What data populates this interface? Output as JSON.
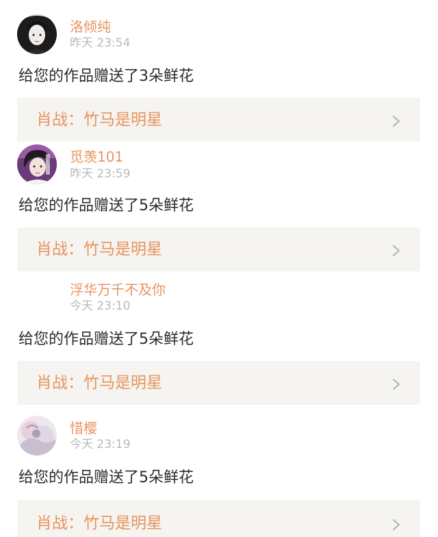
{
  "gifts": [
    {
      "username": "洛倾纯",
      "time": "昨天 23:54",
      "message": "给您的作品赠送了3朵鲜花",
      "work_title": "肖战：竹马是明星",
      "avatar_icon": "avatar-dark-hair-girl-icon"
    },
    {
      "username": "觅羡101",
      "time": "昨天 23:59",
      "message": "给您的作品赠送了5朵鲜花",
      "work_title": "肖战：竹马是明星",
      "avatar_icon": "avatar-boy-purple-icon"
    },
    {
      "username": "浮华万千不及你",
      "time": "今天 23:10",
      "message": "给您的作品赠送了5朵鲜花",
      "work_title": "肖战：竹马是明星",
      "avatar_icon": ""
    },
    {
      "username": "惜樱",
      "time": "今天 23:19",
      "message": "给您的作品赠送了5朵鲜花",
      "work_title": "肖战：竹马是明星",
      "avatar_icon": "avatar-pastel-illustration-icon"
    }
  ],
  "colors": {
    "accent": "#e8935f",
    "timestamp": "#b9b9b9",
    "text": "#2b2b2b",
    "card_bg": "#f5f4f0"
  }
}
